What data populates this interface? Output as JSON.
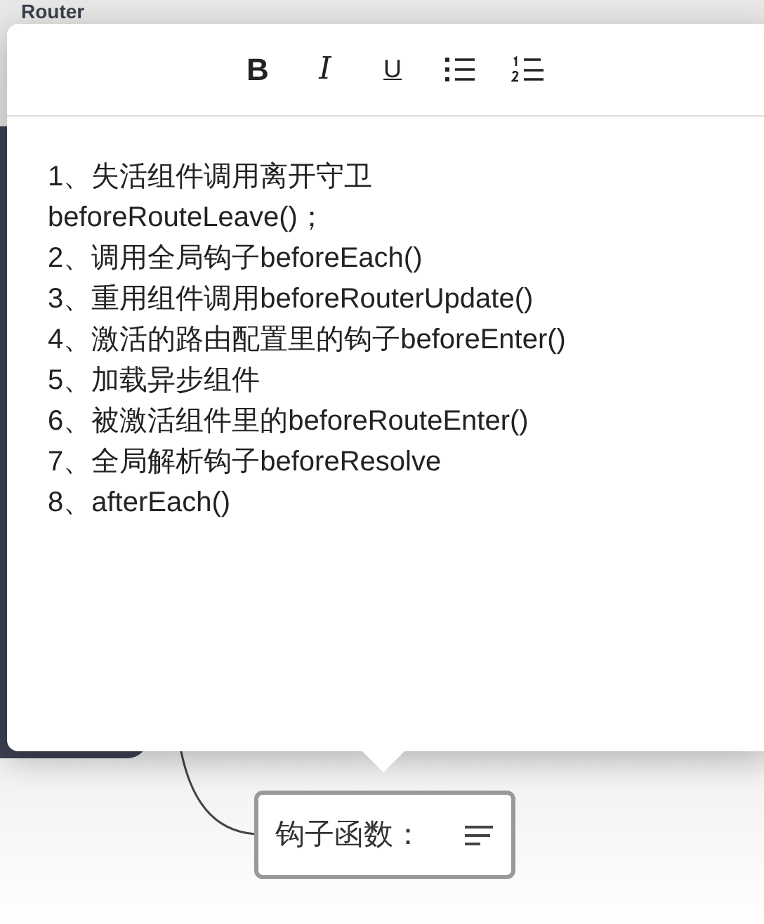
{
  "background_node": {
    "title": "Router"
  },
  "toolbar": [
    {
      "kind": "bold",
      "label": "B"
    },
    {
      "kind": "italic",
      "label": "I"
    },
    {
      "kind": "underline",
      "label": "U"
    },
    {
      "kind": "bullet-list"
    },
    {
      "kind": "numbered-list"
    }
  ],
  "note_lines": [
    "1、失活组件调用离开守卫",
    "beforeRouteLeave()；",
    "2、调用全局钩子beforeEach()",
    "3、重用组件调用beforeRouterUpdate()",
    "4、激活的路由配置里的钩子beforeEnter()",
    "5、加载异步组件",
    "6、被激活组件里的beforeRouteEnter()",
    "7、全局解析钩子beforeResolve",
    "8、afterEach()"
  ],
  "node": {
    "label": "钩子函数："
  }
}
